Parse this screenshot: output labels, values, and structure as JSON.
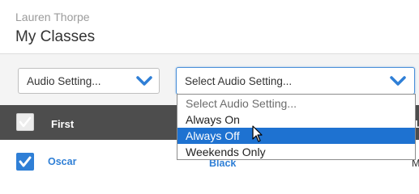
{
  "header": {
    "teacher_name": "Lauren Thorpe",
    "page_title": "My Classes"
  },
  "toolbar": {
    "audio_select": {
      "value": "Audio Setting..."
    },
    "bulk_audio_select": {
      "value": "Select Audio Setting..."
    }
  },
  "table": {
    "columns": {
      "first": "First",
      "last": "La"
    },
    "rows": [
      {
        "checked": true,
        "first": "Oscar",
        "color": "Black",
        "last": "Ma"
      }
    ]
  },
  "dropdown": {
    "options": [
      {
        "label": "Select Audio Setting...",
        "placeholder": true
      },
      {
        "label": "Always On"
      },
      {
        "label": "Always Off",
        "highlighted": true
      },
      {
        "label": "Weekends Only"
      }
    ]
  },
  "colors": {
    "accent": "#2f7fd6",
    "header_bg": "#4d4d4d",
    "toolbar_bg": "#f4f4f4",
    "selected_option_bg": "#1e72d1"
  }
}
